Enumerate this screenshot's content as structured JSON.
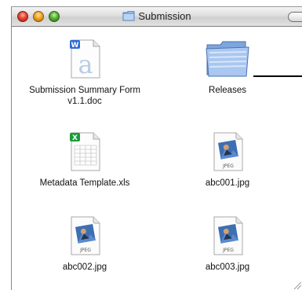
{
  "window": {
    "title": "Submission"
  },
  "items": [
    {
      "name": "Submission Summary Form\nv1.1.doc",
      "line1": "Submission Summary Form",
      "line2": "v1.1.doc",
      "icon": "word-document-icon"
    },
    {
      "name": "Releases",
      "icon": "folder-icon"
    },
    {
      "name": "Metadata Template.xls",
      "icon": "excel-spreadsheet-icon"
    },
    {
      "name": "abc001.jpg",
      "icon": "jpeg-file-icon",
      "badge": "JPEG"
    },
    {
      "name": "abc002.jpg",
      "icon": "jpeg-file-icon",
      "badge": "JPEG"
    },
    {
      "name": "abc003.jpg",
      "icon": "jpeg-file-icon",
      "badge": "JPEG"
    }
  ],
  "colors": {
    "folder": "#8fb2e6",
    "word_badge": "#2f6bd6",
    "excel_badge": "#1d9a3a"
  }
}
